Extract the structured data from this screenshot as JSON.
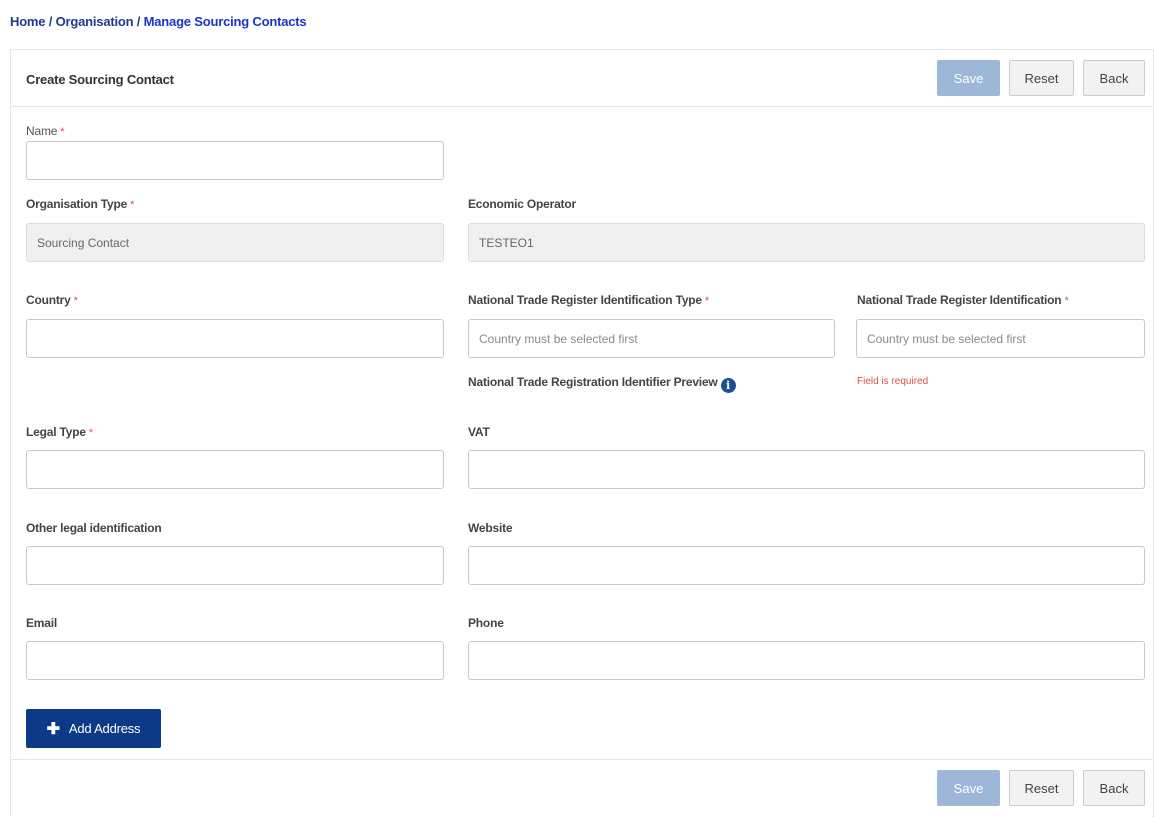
{
  "breadcrumb": {
    "home": "Home",
    "organisation": "Organisation",
    "current": "Manage Sourcing Contacts",
    "separator": "/"
  },
  "form": {
    "title": "Create Sourcing Contact",
    "actions": {
      "save": "Save",
      "reset": "Reset",
      "back": "Back"
    },
    "required_marker": "*",
    "fields": {
      "name": {
        "label": "Name",
        "value": ""
      },
      "organisation_type": {
        "label": "Organisation Type",
        "value": "Sourcing Contact"
      },
      "economic_operator": {
        "label": "Economic Operator",
        "value": "TESTEO1"
      },
      "country": {
        "label": "Country",
        "value": ""
      },
      "ntr_identification_type": {
        "label": "National Trade Register Identification Type",
        "placeholder": "Country must be selected first"
      },
      "ntr_identification": {
        "label": "National Trade Register Identification",
        "placeholder": "Country must be selected first",
        "error": "Field is required"
      },
      "ntr_preview": {
        "label": "National Trade Registration Identifier Preview",
        "icon": "info-circle-icon"
      },
      "legal_type": {
        "label": "Legal Type",
        "value": ""
      },
      "vat": {
        "label": "VAT",
        "value": ""
      },
      "other_legal_identification": {
        "label": "Other legal identification",
        "value": ""
      },
      "website": {
        "label": "Website",
        "value": ""
      },
      "email": {
        "label": "Email",
        "value": ""
      },
      "phone": {
        "label": "Phone",
        "value": ""
      }
    },
    "add_address": {
      "label": "Add Address",
      "icon": "plus-icon"
    }
  },
  "colors": {
    "primary": "#0c3a86",
    "save_disabled": "#9db7d9",
    "required": "#d9534f",
    "breadcrumb_link": "#1f3b8c"
  }
}
